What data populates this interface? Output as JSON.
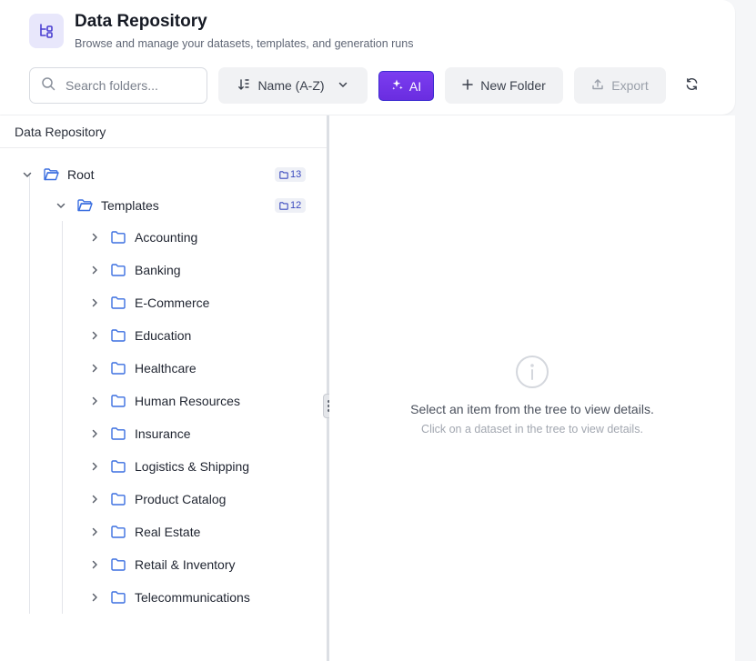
{
  "header": {
    "title": "Data Repository",
    "subtitle": "Browse and manage your datasets, templates, and generation runs",
    "app_icon": "tree-structure-icon"
  },
  "toolbar": {
    "search_placeholder": "Search folders...",
    "search_value": "",
    "sort_label": "Name (A-Z)",
    "ai_label": "AI",
    "new_folder_label": "New Folder",
    "export_label": "Export"
  },
  "tree": {
    "panel_title": "Data Repository",
    "root": {
      "label": "Root",
      "count": "13"
    },
    "templates": {
      "label": "Templates",
      "count": "12"
    },
    "children": [
      "Accounting",
      "Banking",
      "E-Commerce",
      "Education",
      "Healthcare",
      "Human Resources",
      "Insurance",
      "Logistics & Shipping",
      "Product Catalog",
      "Real Estate",
      "Retail & Inventory",
      "Telecommunications"
    ]
  },
  "detail": {
    "empty_title": "Select an item from the tree to view details.",
    "empty_subtitle": "Click on a dataset in the tree to view details."
  },
  "colors": {
    "accent": "#6a2de0",
    "folder_blue": "#3b6fe0",
    "badge_text": "#3b4abf"
  }
}
